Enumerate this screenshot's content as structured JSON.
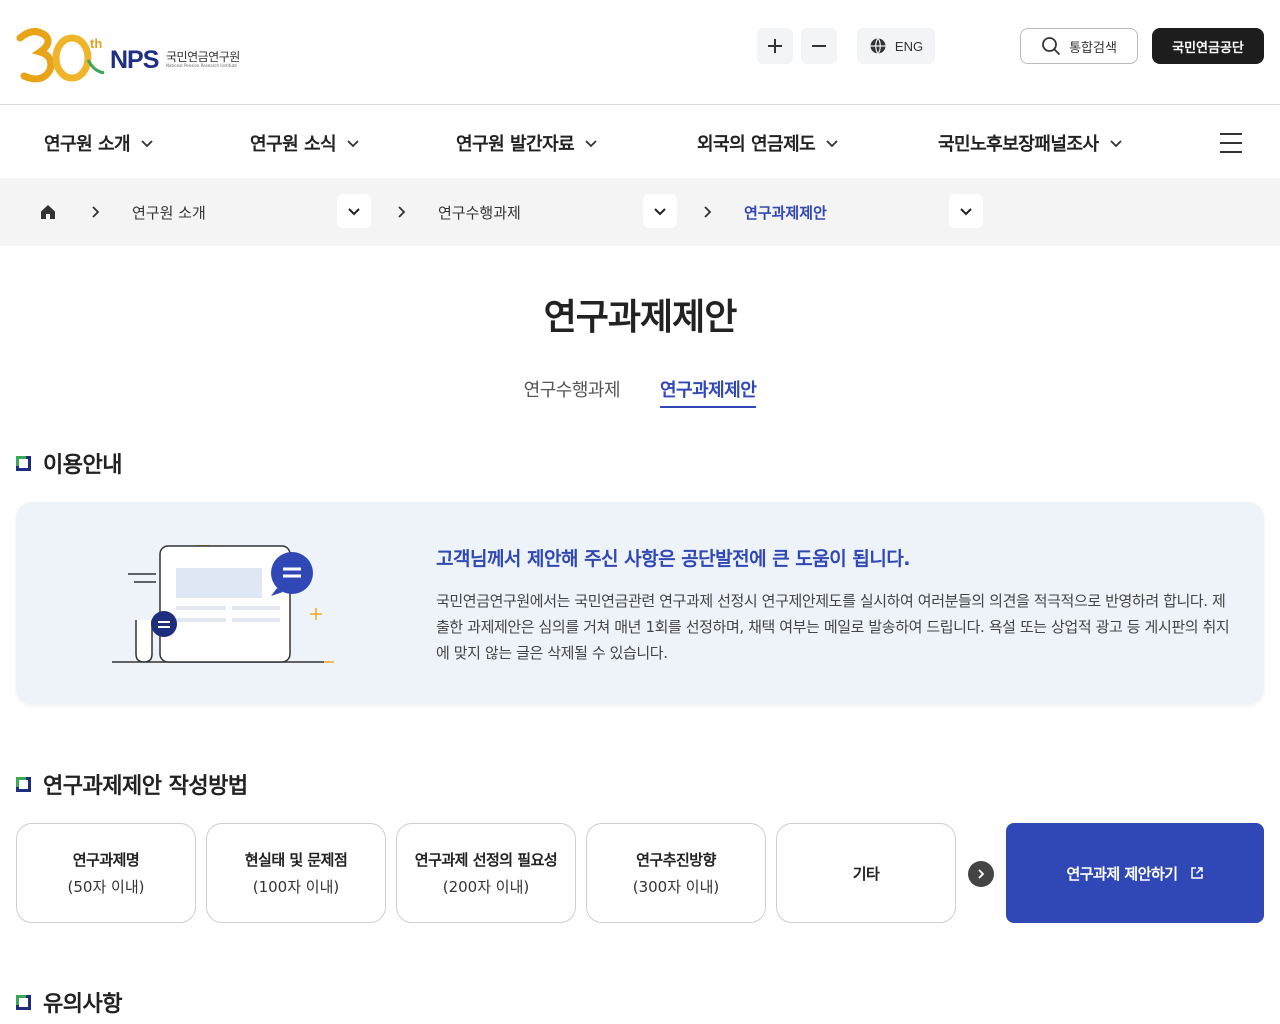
{
  "header": {
    "logo_anniversary": "30",
    "logo_th": "th",
    "logo_brand": "NPS",
    "logo_korean": "국민연금연구원",
    "logo_english": "National Pension Research Institute",
    "lang_label": "ENG",
    "search_label": "통합검색",
    "nps_label": "국민연금공단"
  },
  "gnb": {
    "items": [
      {
        "label": "연구원 소개"
      },
      {
        "label": "연구원 소식"
      },
      {
        "label": "연구원 발간자료"
      },
      {
        "label": "외국의 연금제도"
      },
      {
        "label": "국민노후보장패널조사"
      }
    ]
  },
  "breadcrumb": {
    "items": [
      {
        "label": "연구원 소개"
      },
      {
        "label": "연구수행과제"
      },
      {
        "label": "연구과제제안"
      }
    ]
  },
  "page": {
    "title": "연구과제제안",
    "tabs": [
      {
        "label": "연구수행과제",
        "active": false
      },
      {
        "label": "연구과제제안",
        "active": true
      }
    ]
  },
  "sections": {
    "guide": {
      "heading": "이용안내",
      "info_title": "고객님께서 제안해 주신 사항은 공단발전에 큰 도움이 됩니다.",
      "info_desc": "국민연금연구원에서는 국민연금관련 연구과제 선정시 연구제안제도를 실시하여 여러분들의 의견을 적극적으로 반영하려 합니다. 제출한 과제제안은 심의를 거쳐 매년 1회를 선정하며, 채택 여부는 메일로 발송하여 드립니다. 욕설 또는 상업적 광고 등 게시판의 취지에 맞지 않는 글은 삭제될 수 있습니다."
    },
    "method": {
      "heading": "연구과제제안 작성방법",
      "cards": [
        {
          "title": "연구과제명",
          "sub": "(50자 이내)"
        },
        {
          "title": "현실태 및 문제점",
          "sub": "(100자 이내)"
        },
        {
          "title": "연구과제 선정의 필요성",
          "sub": "(200자 이내)"
        },
        {
          "title": "연구추진방향",
          "sub": "(300자 이내)"
        },
        {
          "title": "기타",
          "sub": ""
        }
      ],
      "propose_label": "연구과제 제안하기"
    },
    "notice": {
      "heading": "유의사항"
    }
  },
  "colors": {
    "primary": "#2f48b5",
    "dark": "#1d1d1d",
    "info_bg": "#eef3f9",
    "accent_green": "#3aa857",
    "accent_orange": "#f5a623"
  }
}
